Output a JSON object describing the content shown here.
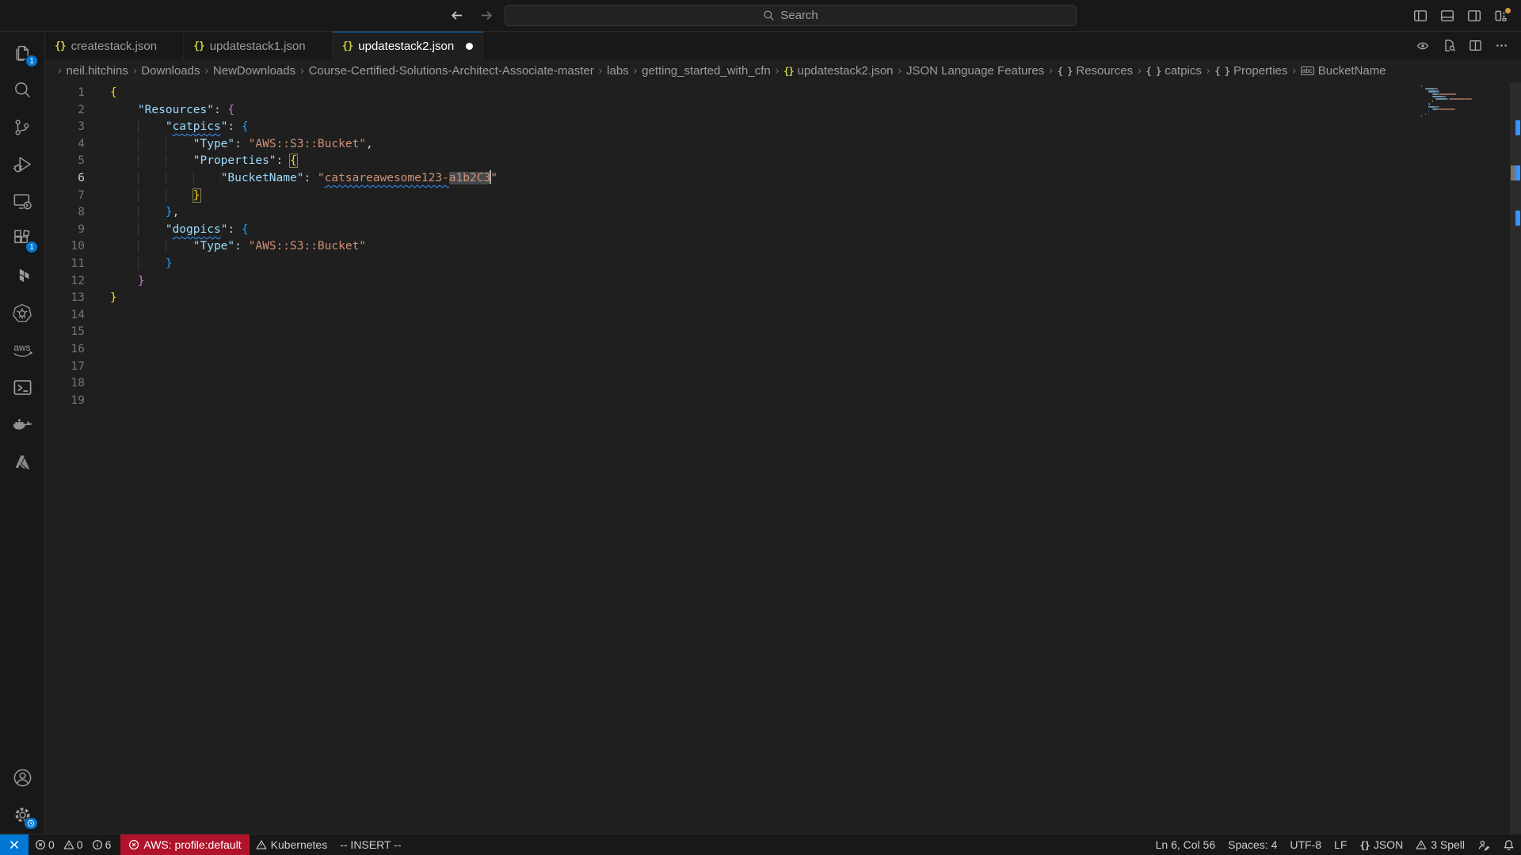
{
  "titlebar": {
    "search_placeholder": "Search",
    "nav": [
      {
        "id": "back"
      },
      {
        "id": "forward",
        "disabled": true
      }
    ],
    "layout_controls": [
      {
        "id": "toggle-primary-sidebar",
        "icon": "layout-left"
      },
      {
        "id": "toggle-panel",
        "icon": "layout-bottom"
      },
      {
        "id": "toggle-secondary-sidebar",
        "icon": "layout-right"
      },
      {
        "id": "customize-layout",
        "icon": "layout-custom",
        "badge_dot": true
      }
    ]
  },
  "activity_bar": {
    "top": [
      {
        "id": "explorer",
        "badge": "1"
      },
      {
        "id": "search"
      },
      {
        "id": "source-control"
      },
      {
        "id": "run-and-debug"
      },
      {
        "id": "remote-explorer"
      },
      {
        "id": "extensions",
        "badge": "1"
      },
      {
        "id": "terraform"
      },
      {
        "id": "kubernetes"
      },
      {
        "id": "aws"
      },
      {
        "id": "terminal"
      },
      {
        "id": "docker"
      },
      {
        "id": "azure"
      }
    ],
    "bottom": [
      {
        "id": "accounts"
      },
      {
        "id": "settings",
        "badge": "clock"
      }
    ]
  },
  "tabs": [
    {
      "label": "createstack.json",
      "active": false,
      "modified": false
    },
    {
      "label": "updatestack1.json",
      "active": false,
      "modified": false
    },
    {
      "label": "updatestack2.json",
      "active": true,
      "modified": true
    }
  ],
  "editor_actions": [
    {
      "id": "toggle-preview",
      "icon": "eye"
    },
    {
      "id": "open-preview-search",
      "icon": "doc-search"
    },
    {
      "id": "split-editor",
      "icon": "split"
    },
    {
      "id": "more-actions",
      "icon": "ellipsis"
    }
  ],
  "breadcrumb": {
    "items": [
      {
        "label": "neil.hitchins"
      },
      {
        "label": "Downloads"
      },
      {
        "label": "NewDownloads"
      },
      {
        "label": "Course-Certified-Solutions-Architect-Associate-master"
      },
      {
        "label": "labs"
      },
      {
        "label": "getting_started_with_cfn"
      },
      {
        "label": "updatestack2.json",
        "icon": "json-yellow"
      },
      {
        "label": "JSON Language Features"
      },
      {
        "label": "Resources",
        "icon": "object"
      },
      {
        "label": "catpics",
        "icon": "object"
      },
      {
        "label": "Properties",
        "icon": "object"
      },
      {
        "label": "BucketName",
        "icon": "string"
      }
    ]
  },
  "editor": {
    "line_count": 19,
    "active_line": 6,
    "lines": [
      {
        "indent": 0,
        "tokens": [
          {
            "t": "{",
            "c": "b1"
          }
        ]
      },
      {
        "indent": 4,
        "tokens": [
          {
            "t": "\"Resources\"",
            "c": "key"
          },
          {
            "t": ": ",
            "c": "pun"
          },
          {
            "t": "{",
            "c": "b2"
          }
        ]
      },
      {
        "indent": 8,
        "tokens": [
          {
            "t": "\"",
            "c": "key"
          },
          {
            "t": "catpics",
            "c": "key sq"
          },
          {
            "t": "\"",
            "c": "key"
          },
          {
            "t": ": ",
            "c": "pun"
          },
          {
            "t": "{",
            "c": "b3"
          }
        ]
      },
      {
        "indent": 12,
        "tokens": [
          {
            "t": "\"Type\"",
            "c": "key"
          },
          {
            "t": ": ",
            "c": "pun"
          },
          {
            "t": "\"AWS::S3::Bucket\"",
            "c": "str"
          },
          {
            "t": ",",
            "c": "pun"
          }
        ]
      },
      {
        "indent": 12,
        "tokens": [
          {
            "t": "\"Properties\"",
            "c": "key"
          },
          {
            "t": ": ",
            "c": "pun"
          },
          {
            "t": "{",
            "c": "b1 bm"
          }
        ]
      },
      {
        "indent": 16,
        "tokens": [
          {
            "t": "\"BucketName\"",
            "c": "key"
          },
          {
            "t": ": ",
            "c": "pun"
          },
          {
            "t": "\"",
            "c": "str"
          },
          {
            "t": "catsareawesome123-",
            "c": "str sq"
          },
          {
            "t": "a1b2C3",
            "c": "str hl"
          },
          {
            "t": "",
            "c": "cursor"
          },
          {
            "t": "\"",
            "c": "str"
          }
        ]
      },
      {
        "indent": 12,
        "tokens": [
          {
            "t": "}",
            "c": "b1 bm"
          }
        ]
      },
      {
        "indent": 8,
        "tokens": [
          {
            "t": "}",
            "c": "b3"
          },
          {
            "t": ",",
            "c": "pun"
          }
        ]
      },
      {
        "indent": 8,
        "tokens": [
          {
            "t": "\"",
            "c": "key"
          },
          {
            "t": "dogpics",
            "c": "key sq"
          },
          {
            "t": "\"",
            "c": "key"
          },
          {
            "t": ": ",
            "c": "pun"
          },
          {
            "t": "{",
            "c": "b3"
          }
        ]
      },
      {
        "indent": 12,
        "tokens": [
          {
            "t": "\"Type\"",
            "c": "key"
          },
          {
            "t": ": ",
            "c": "pun"
          },
          {
            "t": "\"AWS::S3::Bucket\"",
            "c": "str"
          }
        ]
      },
      {
        "indent": 8,
        "tokens": [
          {
            "t": "}",
            "c": "b3"
          }
        ]
      },
      {
        "indent": 4,
        "tokens": [
          {
            "t": "}",
            "c": "b2"
          }
        ]
      },
      {
        "indent": 0,
        "tokens": [
          {
            "t": "}",
            "c": "b1"
          }
        ]
      },
      {
        "indent": 0,
        "tokens": []
      },
      {
        "indent": 0,
        "tokens": []
      },
      {
        "indent": 0,
        "tokens": []
      },
      {
        "indent": 0,
        "tokens": []
      },
      {
        "indent": 0,
        "tokens": []
      },
      {
        "indent": 0,
        "tokens": []
      }
    ],
    "overview_marks": [
      {
        "line": 3,
        "kind": "info"
      },
      {
        "line": 6,
        "kind": "selection"
      },
      {
        "line": 6,
        "kind": "info"
      },
      {
        "line": 9,
        "kind": "info"
      }
    ]
  },
  "status_bar": {
    "left": [
      {
        "id": "remote",
        "icon": "remote",
        "label": "",
        "kind": "remote"
      },
      {
        "id": "problems",
        "segments": [
          {
            "icon": "error-circle",
            "text": "0"
          },
          {
            "icon": "warning-triangle",
            "text": "0"
          },
          {
            "icon": "info-circle",
            "text": "6"
          }
        ]
      },
      {
        "id": "aws-credentials",
        "icon": "error-circle",
        "label": "AWS: profile:default",
        "kind": "error"
      },
      {
        "id": "kubernetes-context",
        "icon": "warning-triangle",
        "label": "Kubernetes"
      },
      {
        "id": "vim-mode",
        "label": "-- INSERT --"
      }
    ],
    "right": [
      {
        "id": "cursor-position",
        "label": "Ln 6, Col 56"
      },
      {
        "id": "indentation",
        "label": "Spaces: 4"
      },
      {
        "id": "encoding",
        "label": "UTF-8"
      },
      {
        "id": "eol",
        "label": "LF"
      },
      {
        "id": "language-mode",
        "icon": "braces",
        "label": "JSON"
      },
      {
        "id": "spell-checker",
        "icon": "warning-triangle",
        "label": "3 Spell"
      },
      {
        "id": "feedback",
        "icon": "feedback",
        "label": ""
      },
      {
        "id": "notifications",
        "icon": "bell",
        "label": ""
      }
    ]
  },
  "colors": {
    "accent_blue": "#0078d4",
    "badge_blue": "#0078d4",
    "error_badge_red": "#b0132b",
    "info_blue": "#3794ff",
    "json_icon_yellow": "#cbcb41",
    "bracket_gold": "#ffd700",
    "bracket_pink": "#da70d6",
    "bracket_blue": "#179fff",
    "key_blue": "#9cdcfe",
    "string_orange": "#ce9178",
    "orange_dot": "#d89a3e",
    "modified_dot": "#ffffff"
  }
}
